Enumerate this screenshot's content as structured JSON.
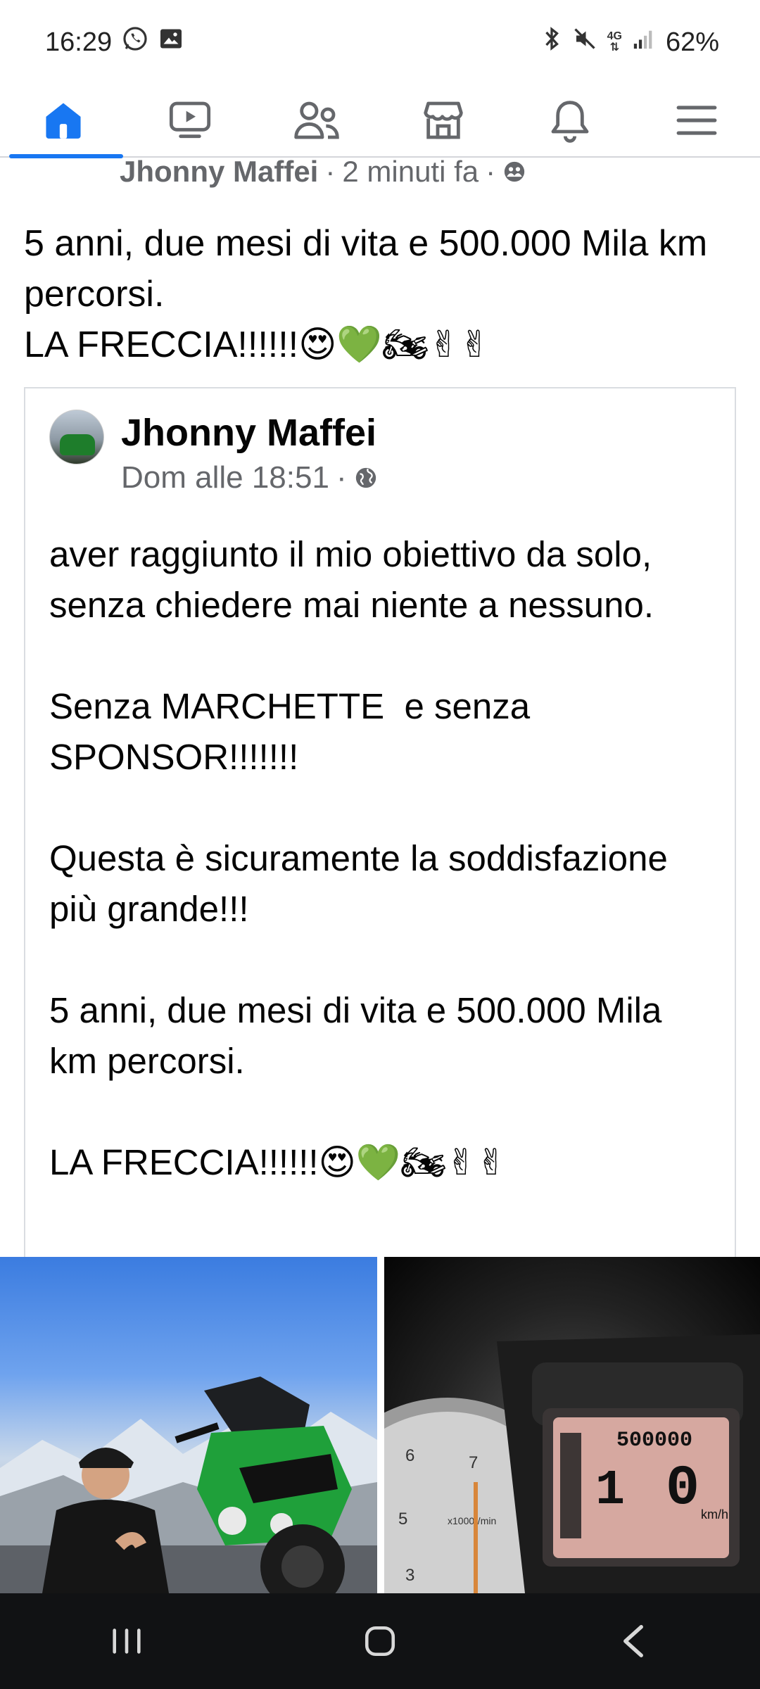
{
  "status_bar": {
    "time": "16:29",
    "left_icons": [
      "whatsapp-icon",
      "gallery-icon"
    ],
    "right_icons": [
      "bluetooth-icon",
      "mute-icon",
      "4g-icon",
      "signal-icon"
    ],
    "network_label": "4G",
    "battery": "62%"
  },
  "tabs": [
    {
      "name": "home",
      "icon": "home-icon",
      "active": true
    },
    {
      "name": "watch",
      "icon": "video-icon",
      "active": false
    },
    {
      "name": "friends",
      "icon": "friends-icon",
      "active": false
    },
    {
      "name": "marketplace",
      "icon": "marketplace-icon",
      "active": false
    },
    {
      "name": "notifications",
      "icon": "bell-icon",
      "active": false
    },
    {
      "name": "menu",
      "icon": "hamburger-menu-icon",
      "active": false
    }
  ],
  "post": {
    "author": "Jhonny Maffei",
    "time": "2 minuti fa",
    "separator": "·",
    "audience_icon": "friends-audience-icon",
    "text_line1": "5 anni, due mesi di vita e 500.000 Mila km percorsi.",
    "text_line2": "LA FRECCIA!!!!!!😍💚🏍✌✌"
  },
  "shared_post": {
    "author": "Jhonny Maffei",
    "time": "Dom alle 18:51",
    "separator": "·",
    "audience_icon": "globe-icon",
    "body": "aver raggiunto il mio obiettivo da solo, senza chiedere mai niente a nessuno.\n\nSenza MARCHETTE  e senza SPONSOR!!!!!!!\n\nQuesta è sicuramente la soddisfazione più grande!!!\n\n5 anni, due mesi di vita e 500.000 Mila km percorsi.\n\nLA FRECCIA!!!!!!😍💚🏍✌✌"
  },
  "photos": [
    {
      "name": "rider-with-motorcycle-photo"
    },
    {
      "name": "odometer-photo",
      "odometer_reading": "500000",
      "gear": "1",
      "speed": "0",
      "speed_unit": "km/h",
      "rpm_unit": "x1000r/min"
    }
  ],
  "nav_bar": {
    "buttons": [
      "recent-apps-icon",
      "home-button-icon",
      "back-icon"
    ]
  },
  "colors": {
    "accent": "#1877f2",
    "secondary_text": "#65676b",
    "nav_bg": "#111214"
  }
}
